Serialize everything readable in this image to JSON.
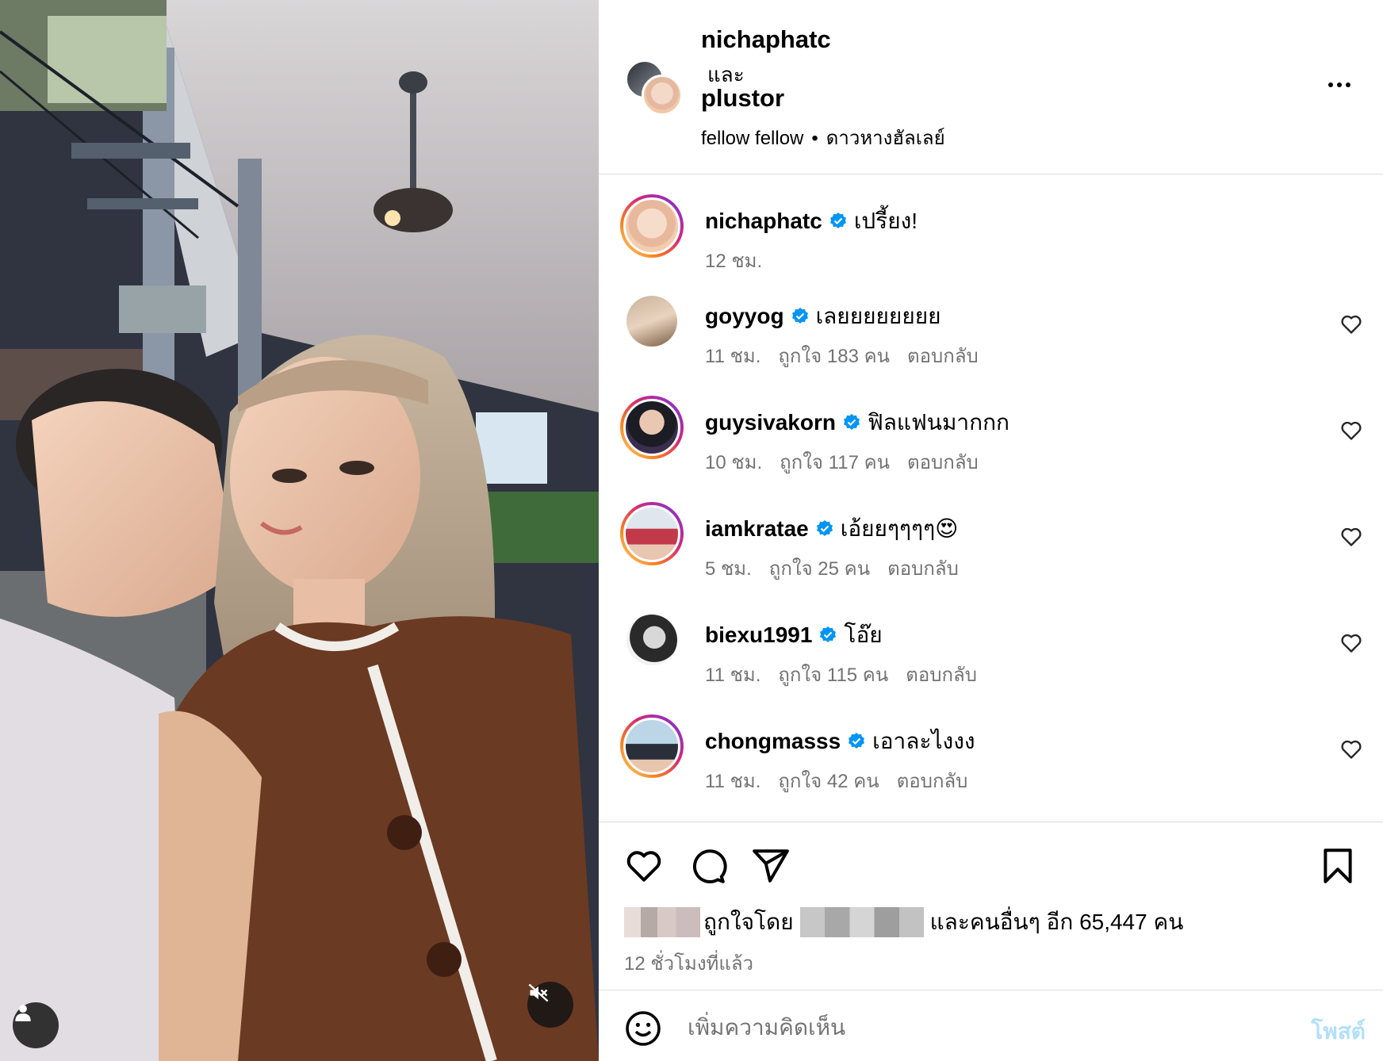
{
  "post": {
    "author": "nichaphatc",
    "and_text": "และ",
    "collaborator": "plustor",
    "audio": {
      "artist": "fellow fellow",
      "separator": "•",
      "title": "ดาวหางฮัลเลย์"
    },
    "more_icon": "more-horizontal-icon"
  },
  "caption": {
    "user": "nichaphatc",
    "text": "เปรี้ยง!",
    "time": "12 ชม."
  },
  "comments": [
    {
      "user": "goyyog",
      "text": "เลยยยยยยยย",
      "time": "11 ชม.",
      "likes": "ถูกใจ 183 คน",
      "reply": "ตอบกลับ"
    },
    {
      "user": "guysivakorn",
      "text": "ฟิลแฟนมากกก",
      "time": "10 ชม.",
      "likes": "ถูกใจ 117 คน",
      "reply": "ตอบกลับ"
    },
    {
      "user": "iamkratae",
      "text": "เอ้ยยๆๆๆๆ😍",
      "time": "5 ชม.",
      "likes": "ถูกใจ 25 คน",
      "reply": "ตอบกลับ"
    },
    {
      "user": "biexu1991",
      "text": "โอ๊ย",
      "time": "11 ชม.",
      "likes": "ถูกใจ 115 คน",
      "reply": "ตอบกลับ"
    },
    {
      "user": "chongmasss",
      "text": "เอาละไงงง",
      "time": "11 ชม.",
      "likes": "ถูกใจ 42 คน",
      "reply": "ตอบกลับ"
    }
  ],
  "likes_line": {
    "liked_by": "ถูกใจโดย",
    "others": "และคนอื่นๆ อีก 65,447 คน"
  },
  "posted_time": "12 ชั่วโมงที่แล้ว",
  "add_comment": {
    "placeholder": "เพิ่มความคิดเห็น",
    "post_label": "โพสต์"
  },
  "colors": {
    "verified": "#0095f6",
    "muted_text": "#737373",
    "post_disabled": "#b2dffc"
  }
}
